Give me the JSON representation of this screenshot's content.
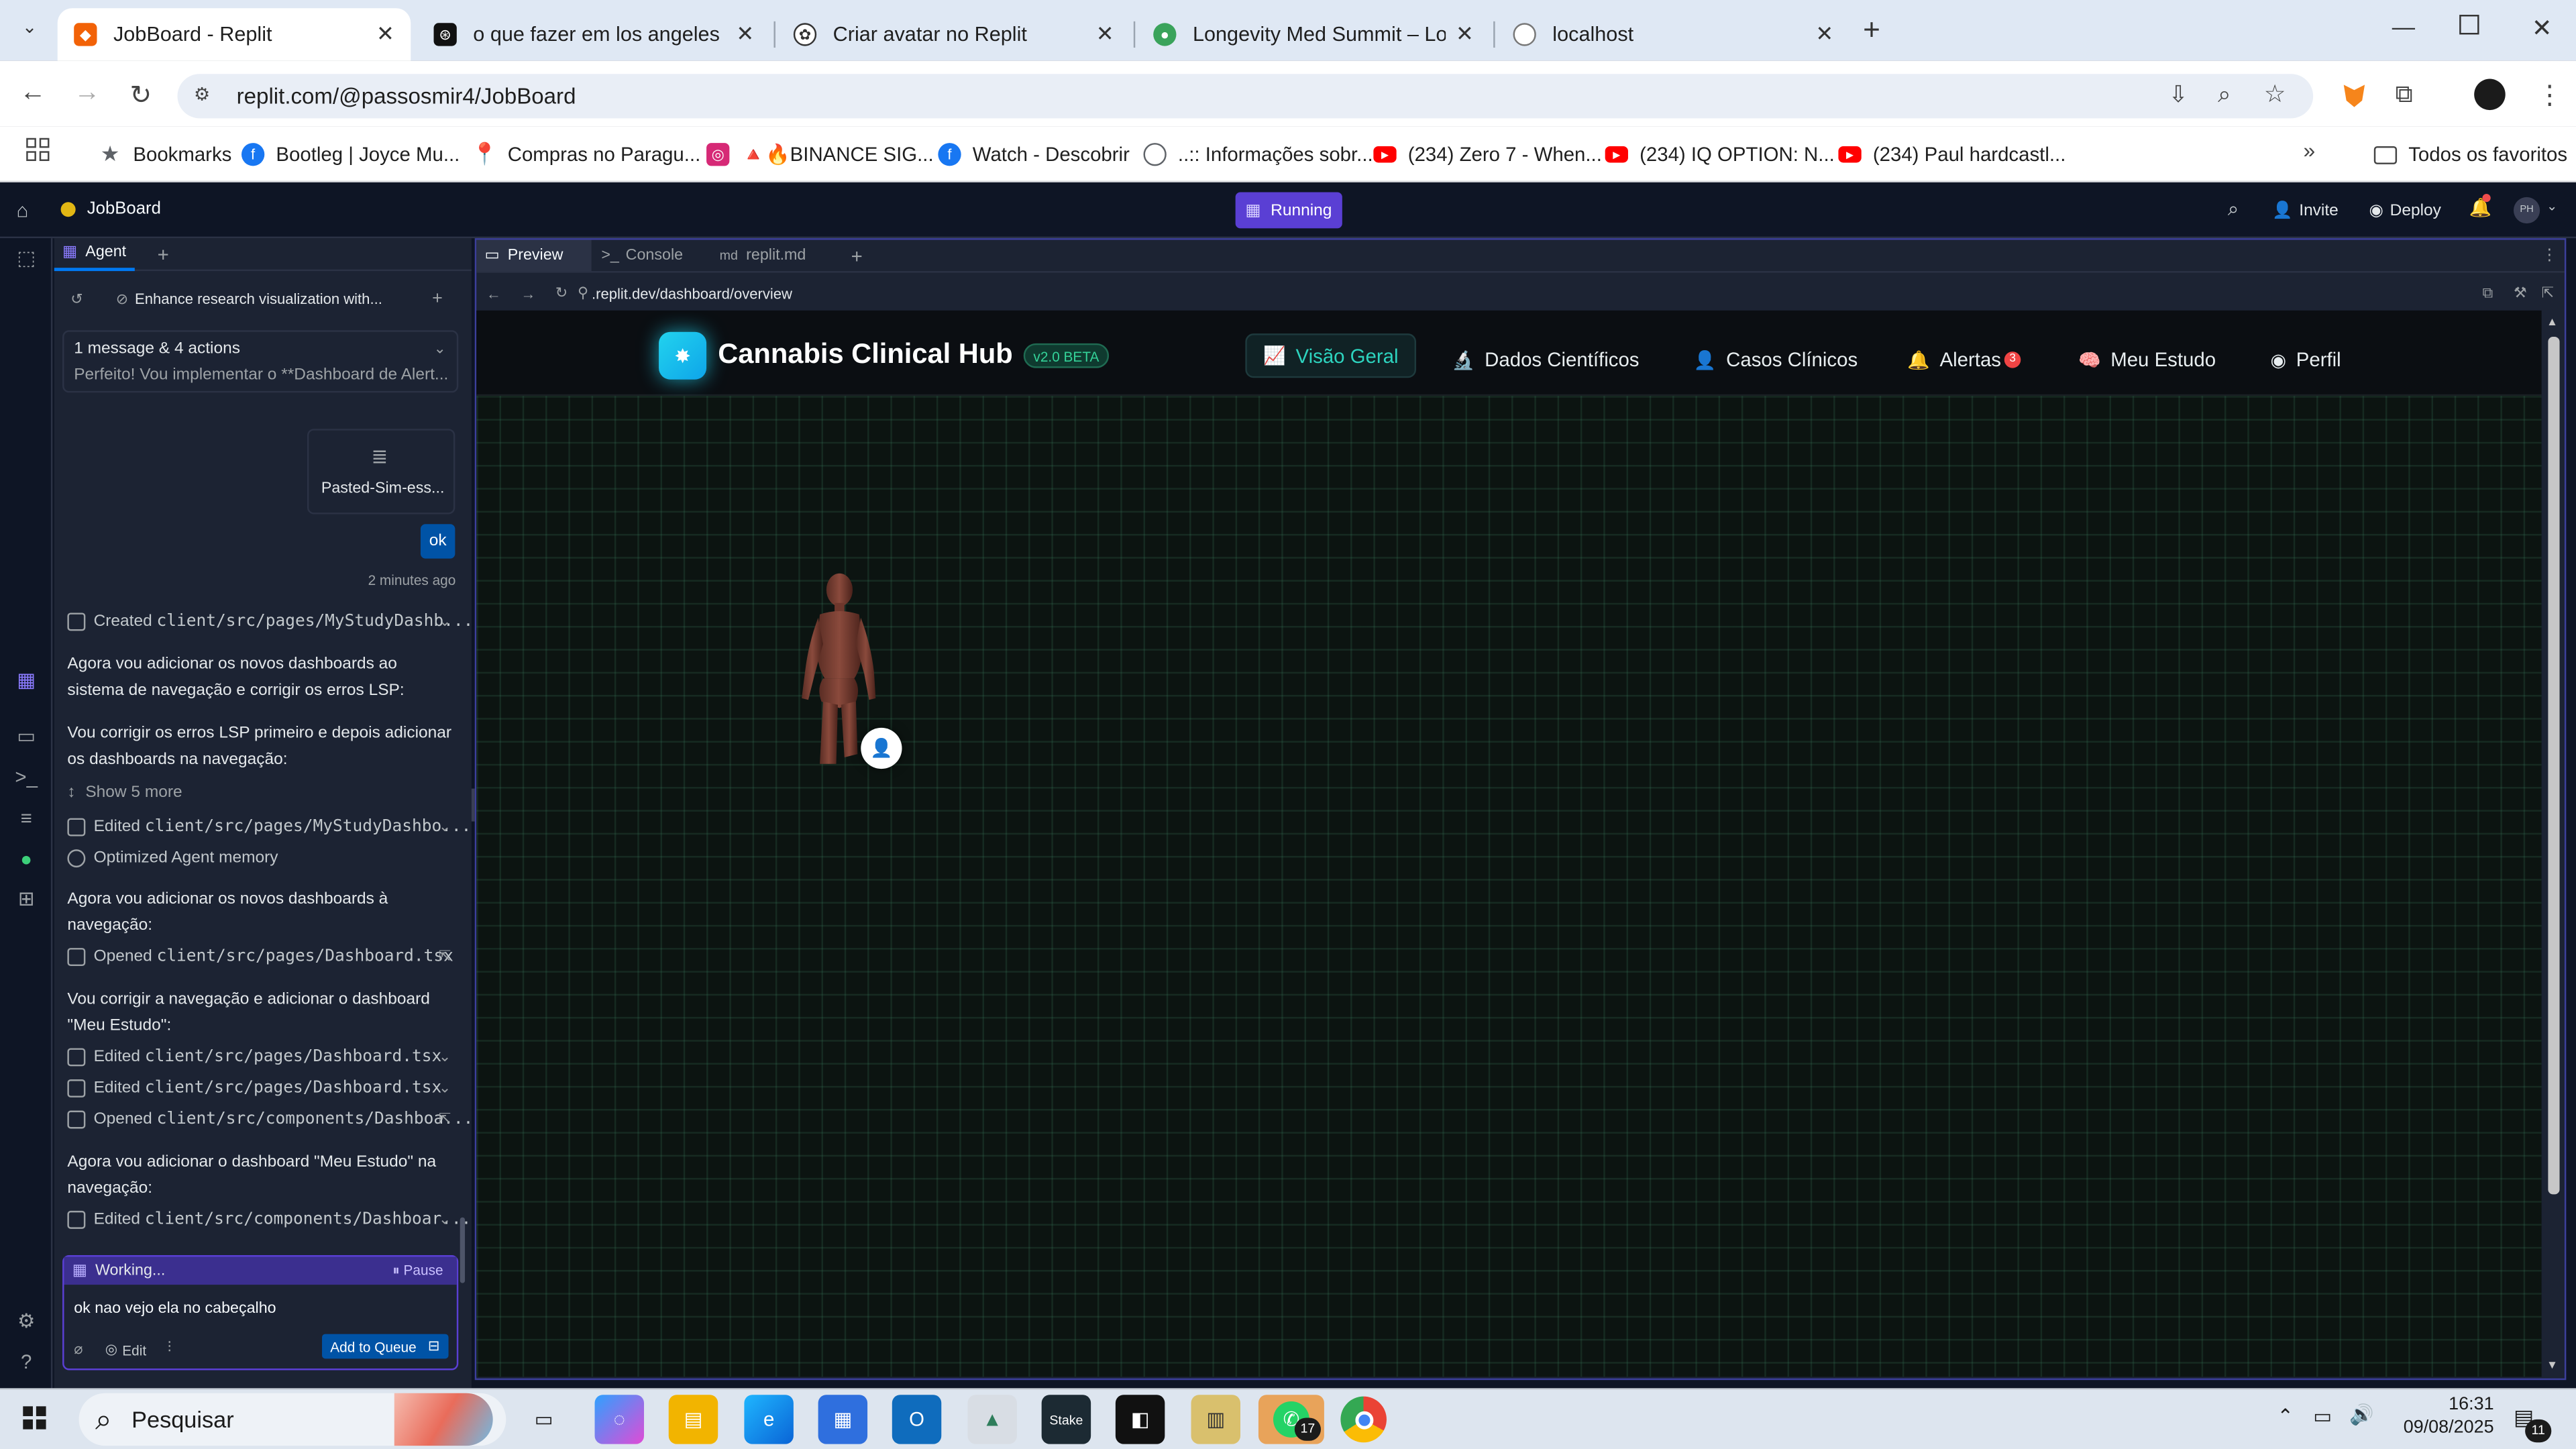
{
  "browser": {
    "tabs": [
      {
        "title": "JobBoard - Replit",
        "icon": "replit-icon",
        "color": "#f26207"
      },
      {
        "title": "o que fazer em los angeles",
        "icon": "chatgpt-icon",
        "color": "#111111"
      },
      {
        "title": "Criar avatar no Replit",
        "icon": "openai-icon",
        "color": "#333333"
      },
      {
        "title": "Longevity Med Summit – Longe",
        "icon": "globe-green-icon",
        "color": "#3aa35b"
      },
      {
        "title": "localhost",
        "icon": "globe-icon",
        "color": "#888888"
      }
    ],
    "url": "replit.com/@passosmir4/JobBoard",
    "bookmarks": [
      {
        "label": "Bookmarks",
        "icon": "star-icon",
        "color": "#5f6368"
      },
      {
        "label": "Bootleg | Joyce Mu...",
        "icon": "facebook-icon",
        "color": "#1877f2"
      },
      {
        "label": "Compras no Paragu...",
        "icon": "pin-icon",
        "color": "#d93025"
      },
      {
        "label": "🔺🔥BINANCE SIG...",
        "icon": "instagram-icon",
        "color": "#d62976"
      },
      {
        "label": "Watch - Descobrir",
        "icon": "facebook-icon",
        "color": "#1877f2"
      },
      {
        "label": "..:: Informações sobr...",
        "icon": "globe-icon",
        "color": "#5f6368"
      },
      {
        "label": "(234) Zero 7 - When...",
        "icon": "youtube-icon",
        "color": "#ff0000"
      },
      {
        "label": "(234) IQ OPTION: N...",
        "icon": "youtube-icon",
        "color": "#ff0000"
      },
      {
        "label": "(234) Paul hardcastl...",
        "icon": "youtube-icon",
        "color": "#ff0000"
      }
    ],
    "all_bookmarks": "Todos os favoritos"
  },
  "replit": {
    "project": "JobBoard",
    "status": "Running",
    "invite": "Invite",
    "deploy": "Deploy",
    "avatar_initials": "PH",
    "agent_tab": "Agent",
    "thread_title": "Enhance research visualization with...",
    "summary_title": "1 message & 4 actions",
    "summary_sub": "Perfeito! Vou implementar o **Dashboard de Alert...",
    "attachment": "Pasted-Sim-ess...",
    "user_msg": "ok",
    "timestamp": "2 minutes ago",
    "items": [
      {
        "kind": "action",
        "verb": "Created",
        "path": "client/src/pages/MyStudyDashb...",
        "chev": true
      },
      {
        "kind": "text",
        "text": "Agora vou adicionar os novos dashboards ao sistema de navegação e corrigir os erros LSP:"
      },
      {
        "kind": "text",
        "text": "Vou corrigir os erros LSP primeiro e depois adicionar os dashboards na navegação:"
      },
      {
        "kind": "more",
        "text": "Show 5 more"
      },
      {
        "kind": "action",
        "verb": "Edited",
        "path": "client/src/pages/MyStudyDashbo...",
        "chev": true
      },
      {
        "kind": "memory",
        "text": "Optimized Agent memory"
      },
      {
        "kind": "text",
        "text": "Agora vou adicionar os novos dashboards à navegação:"
      },
      {
        "kind": "action",
        "verb": "Opened",
        "path": "client/src/pages/Dashboard.tsx",
        "link": true
      },
      {
        "kind": "text",
        "text": "Vou corrigir a navegação e adicionar o dashboard \"Meu Estudo\":"
      },
      {
        "kind": "action",
        "verb": "Edited",
        "path": "client/src/pages/Dashboard.tsx",
        "chev": true
      },
      {
        "kind": "action",
        "verb": "Edited",
        "path": "client/src/pages/Dashboard.tsx",
        "chev": true
      },
      {
        "kind": "action",
        "verb": "Opened",
        "path": "client/src/components/Dashboa...",
        "link": true
      },
      {
        "kind": "text",
        "text": "Agora vou adicionar o dashboard \"Meu Estudo\" na navegação:"
      },
      {
        "kind": "action",
        "verb": "Edited",
        "path": "client/src/components/Dashboar...",
        "chev": true
      }
    ],
    "working": "Working...",
    "pause": "Pause",
    "input_value": "ok nao vejo ela no cabeçalho",
    "edit_label": "Edit",
    "queue_label": "Add to Queue",
    "preview_tabs": [
      "Preview",
      "Console",
      "replit.md"
    ],
    "preview_url": ".replit.dev/dashboard/overview"
  },
  "app": {
    "title": "Cannabis Clinical Hub",
    "version": "v2.0 BETA",
    "nav": [
      "Visão Geral",
      "Dados Científicos",
      "Casos Clínicos",
      "Alertas",
      "Meu Estudo",
      "Perfil"
    ],
    "alert_count": "3",
    "accent": "#2dd4bf"
  },
  "taskbar": {
    "search": "Pesquisar",
    "whatsapp_badge": "17",
    "time": "16:31",
    "date": "09/08/2025",
    "notif_count": "11"
  }
}
